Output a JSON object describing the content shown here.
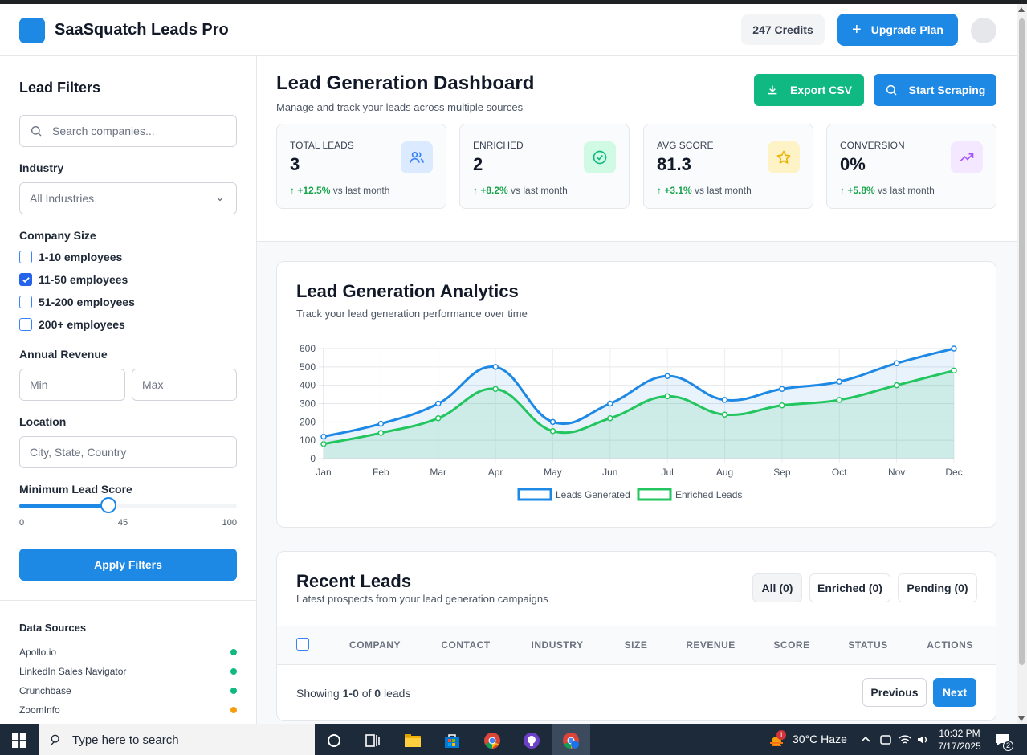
{
  "header": {
    "title": "SaaSquatch Leads Pro",
    "credits": "247 Credits",
    "upgrade_label": "Upgrade Plan"
  },
  "sidebar": {
    "title": "Lead Filters",
    "search_placeholder": "Search companies...",
    "industry_label": "Industry",
    "industry_value": "All Industries",
    "company_size_label": "Company Size",
    "sizes": [
      {
        "label": "1-10 employees",
        "checked": false
      },
      {
        "label": "11-50 employees",
        "checked": true
      },
      {
        "label": "51-200 employees",
        "checked": false
      },
      {
        "label": "200+ employees",
        "checked": false
      }
    ],
    "revenue_label": "Annual Revenue",
    "revenue_min_placeholder": "Min",
    "revenue_max_placeholder": "Max",
    "location_label": "Location",
    "location_placeholder": "City, State, Country",
    "score_label": "Minimum Lead Score",
    "score": {
      "min": "0",
      "value": "45",
      "max": "100",
      "fraction": 0.45
    },
    "apply_label": "Apply Filters",
    "data_sources_title": "Data Sources",
    "data_sources": [
      {
        "name": "Apollo.io",
        "color": "#10b981"
      },
      {
        "name": "LinkedIn Sales Navigator",
        "color": "#10b981"
      },
      {
        "name": "Crunchbase",
        "color": "#10b981"
      },
      {
        "name": "ZoomInfo",
        "color": "#f59e0b"
      }
    ]
  },
  "dashboard": {
    "title": "Lead Generation Dashboard",
    "subtitle": "Manage and track your leads across multiple sources",
    "export_label": "Export CSV",
    "scrape_label": "Start Scraping",
    "stats": [
      {
        "label": "TOTAL LEADS",
        "value": "3",
        "change": "+12.5%",
        "suffix": "vs last month",
        "icon": "users-icon",
        "color": "#3b82f6",
        "bg": "#dbeafe"
      },
      {
        "label": "ENRICHED",
        "value": "2",
        "change": "+8.2%",
        "suffix": "vs last month",
        "icon": "check-circle-icon",
        "color": "#10b981",
        "bg": "#d1fae5"
      },
      {
        "label": "AVG SCORE",
        "value": "81.3",
        "change": "+3.1%",
        "suffix": "vs last month",
        "icon": "star-icon",
        "color": "#eab308",
        "bg": "#fef3c7"
      },
      {
        "label": "CONVERSION",
        "value": "0%",
        "change": "+5.8%",
        "suffix": "vs last month",
        "icon": "trending-up-icon",
        "color": "#a855f7",
        "bg": "#f3e8ff"
      }
    ]
  },
  "analytics": {
    "title": "Lead Generation Analytics",
    "subtitle": "Track your lead generation performance over time"
  },
  "chart_data": {
    "type": "area",
    "categories": [
      "Jan",
      "Feb",
      "Mar",
      "Apr",
      "May",
      "Jun",
      "Jul",
      "Aug",
      "Sep",
      "Oct",
      "Nov",
      "Dec"
    ],
    "series": [
      {
        "name": "Leads Generated",
        "values": [
          120,
          190,
          300,
          500,
          200,
          300,
          450,
          320,
          380,
          420,
          520,
          600
        ],
        "color": "#1e88e5"
      },
      {
        "name": "Enriched Leads",
        "values": [
          80,
          140,
          220,
          380,
          150,
          220,
          340,
          240,
          290,
          320,
          400,
          480
        ],
        "color": "#22c55e"
      }
    ],
    "ylim": [
      0,
      600
    ],
    "yticks": [
      "0",
      "100",
      "200",
      "300",
      "400",
      "500",
      "600"
    ],
    "grid": true,
    "legend": "bottom"
  },
  "recent": {
    "title": "Recent Leads",
    "subtitle": "Latest prospects from your lead generation campaigns",
    "filters": [
      "All (0)",
      "Enriched (0)",
      "Pending (0)"
    ],
    "columns": [
      "COMPANY",
      "CONTACT",
      "INDUSTRY",
      "SIZE",
      "REVENUE",
      "SCORE",
      "STATUS",
      "ACTIONS"
    ],
    "showing_prefix": "Showing",
    "showing_range": "1-0",
    "showing_of": "of",
    "showing_total": "0",
    "showing_suffix": "leads",
    "prev_label": "Previous",
    "next_label": "Next"
  },
  "taskbar": {
    "search_placeholder": "Type here to search",
    "weather": "30°C  Haze",
    "weather_badge": "1",
    "time": "10:32 PM",
    "date": "7/17/2025",
    "notif_count": "2"
  }
}
